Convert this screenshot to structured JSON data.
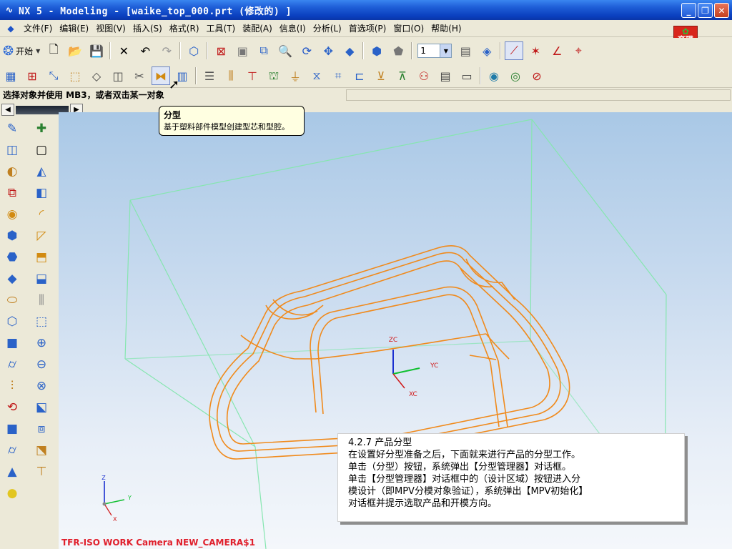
{
  "window": {
    "title": "NX 5 - Modeling - [waike_top_000.prt  (修改的) ]",
    "controls": {
      "minimize": "_",
      "restore": "❐",
      "close": "✕"
    }
  },
  "menu": {
    "items": [
      "文件(F)",
      "编辑(E)",
      "视图(V)",
      "插入(S)",
      "格式(R)",
      "工具(T)",
      "装配(A)",
      "信息(I)",
      "分析(L)",
      "首选项(P)",
      "窗口(O)",
      "帮助(H)"
    ]
  },
  "logo": {
    "line1": "育碟",
    "line2": "软件"
  },
  "toolbar": {
    "start_label": "开始",
    "layer_value": "1",
    "icons": [
      "new-file-icon",
      "open-folder-icon",
      "save-icon",
      "delete-icon",
      "undo-icon",
      "redo-icon",
      "select-filter-icon",
      "fit-icon",
      "display-icon",
      "zoom-window-icon",
      "zoom-icon",
      "rotate-icon",
      "pan-icon",
      "shaded-icon",
      "orient-view-icon",
      "render-style-icon",
      "move-layer-icon",
      "wcs-icon",
      "snap-icons"
    ]
  },
  "mold_toolbar": {
    "icons": [
      "project-init-icon",
      "mold-csys-icon",
      "shrinkage-icon",
      "workpiece-icon",
      "layout-icon",
      "family-mold-icon",
      "mold-tools-icon",
      "parting-icon",
      "moldbase-icon",
      "standard-parts-icon",
      "ejector-icon",
      "slider-icon",
      "sub-insert-icon",
      "gate-icon",
      "runner-icon",
      "cooling-icon",
      "electrode-icon",
      "trim-icon",
      "pocket-icon",
      "bom-icon",
      "drawing-icon",
      "hole-table-icon",
      "view-manager-icon",
      "remove-icon",
      "eye-icon",
      "close-icon"
    ]
  },
  "cue_line": "选择对象并使用 MB3，或者双击某一对象",
  "tooltip": {
    "title": "分型",
    "description": "基于塑料部件模型创建型芯和型腔。"
  },
  "viewport": {
    "camera_label": "TFR-ISO WORK Camera NEW_CAMERA$1",
    "wcs_labels": {
      "z": "ZC",
      "y": "YC",
      "x": "XC"
    },
    "triad_labels": {
      "z": "Z",
      "y": "Y",
      "x": "X"
    },
    "colors": {
      "part": "#f08a1c",
      "box": "#86e6b0",
      "z_axis": "#1a2fd0",
      "y_axis": "#10c030",
      "x_axis": "#d01818"
    }
  },
  "annotation": {
    "heading": "4.2.7 产品分型",
    "lines": [
      "在设置好分型准备之后，下面就来进行产品的分型工作。",
      "单击（分型）按钮，系统弹出【分型管理器】对话框。",
      "单击【分型管理器】对话框中的（设计区域）按钮进入分",
      "模设计（即MPV分模对象验证），系统弹出【MPV初始化】",
      "对话框并提示选取产品和开模方向。"
    ]
  }
}
